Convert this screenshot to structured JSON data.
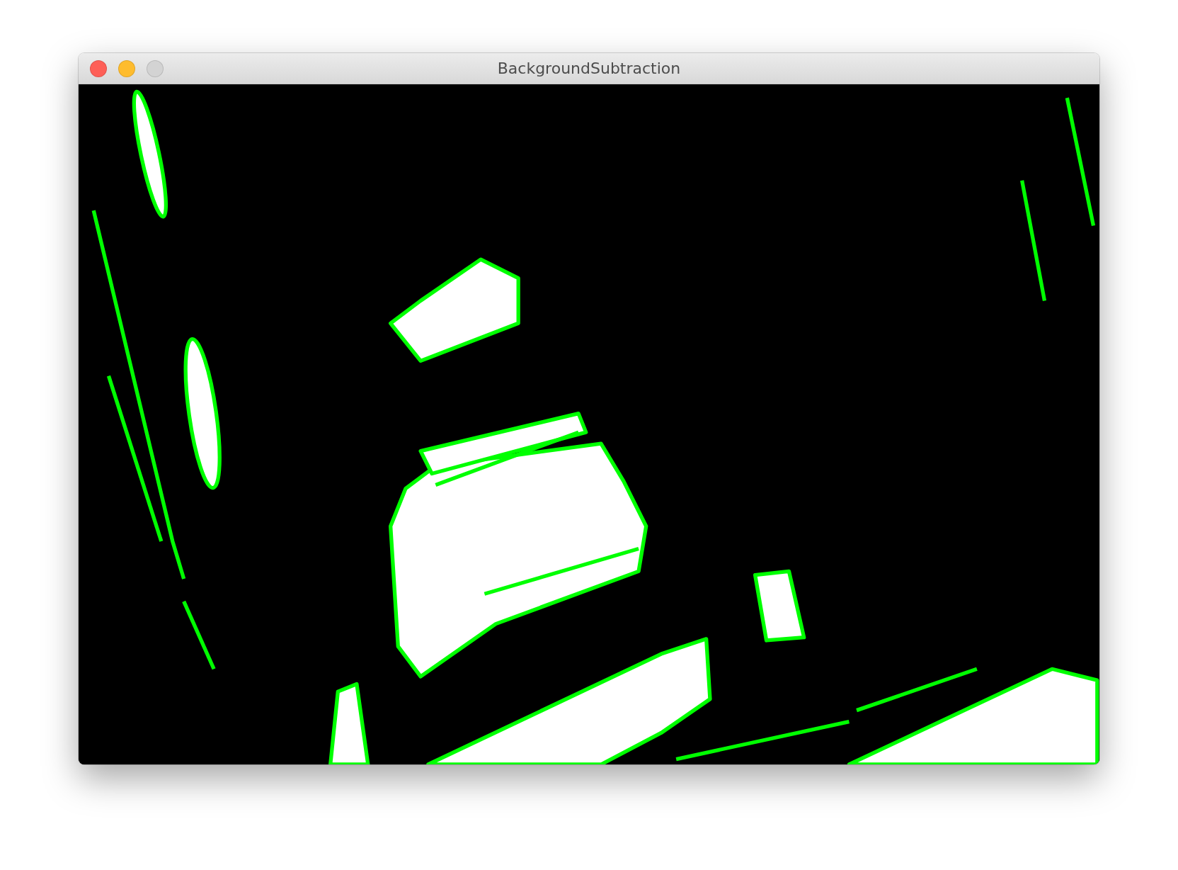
{
  "window": {
    "title": "BackgroundSubtraction",
    "buttons": [
      {
        "kind": "close",
        "disabled": false
      },
      {
        "kind": "minimize",
        "disabled": false
      },
      {
        "kind": "zoom",
        "disabled": true
      }
    ]
  }
}
